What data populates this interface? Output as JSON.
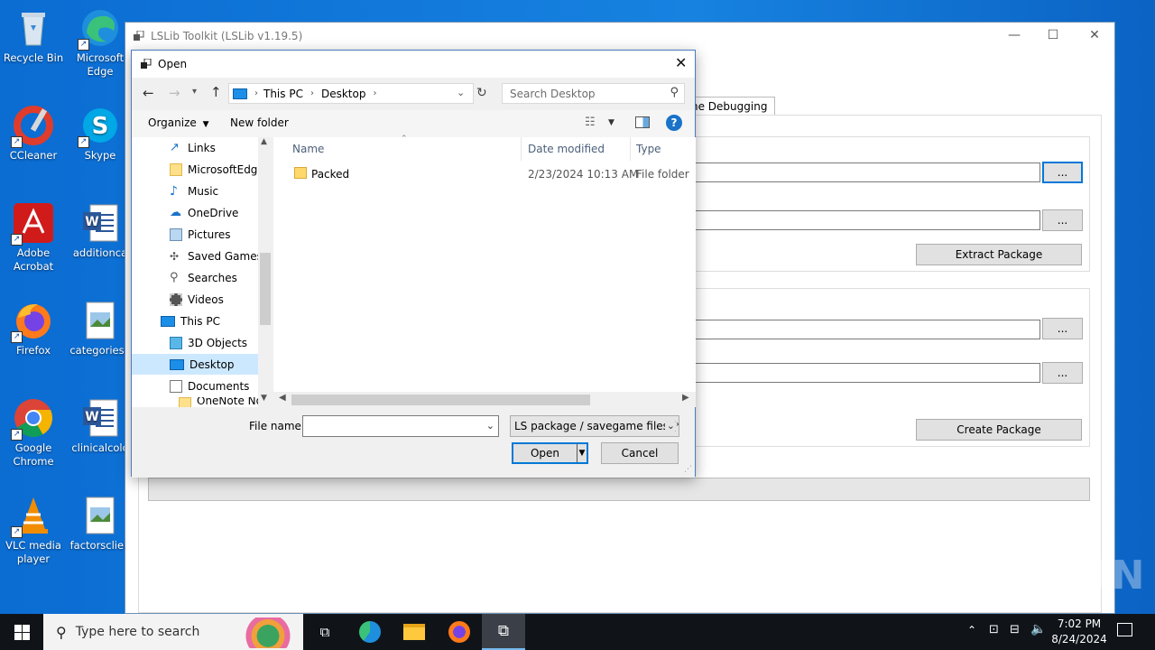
{
  "desktop": {
    "icons": [
      {
        "label1": "Recycle Bin",
        "label2": ""
      },
      {
        "label1": "Microsoft",
        "label2": "Edge"
      },
      {
        "label1": "CCleaner",
        "label2": ""
      },
      {
        "label1": "Skype",
        "label2": ""
      },
      {
        "label1": "Adobe",
        "label2": "Acrobat"
      },
      {
        "label1": "additionca",
        "label2": ""
      },
      {
        "label1": "Firefox",
        "label2": ""
      },
      {
        "label1": "categoriesa",
        "label2": ""
      },
      {
        "label1": "Google",
        "label2": "Chrome"
      },
      {
        "label1": "clinicalcolo",
        "label2": ""
      },
      {
        "label1": "VLC media",
        "label2": "player"
      },
      {
        "label1": "factorsclien",
        "label2": ""
      }
    ]
  },
  "main_window": {
    "title": "LSLib Toolkit (LSLib v1.19.5)",
    "tab_label": "ne Debugging",
    "browse_label": "...",
    "extract_label": "Extract Package",
    "create_label": "Create Package"
  },
  "dialog": {
    "title": "Open",
    "breadcrumb": [
      "This PC",
      "Desktop"
    ],
    "search_placeholder": "Search Desktop",
    "organize_label": "Organize",
    "new_folder_label": "New folder",
    "nav_items": [
      {
        "label": "Links",
        "icon": "link-icon"
      },
      {
        "label": "MicrosoftEdge",
        "icon": "folder-icon"
      },
      {
        "label": "Music",
        "icon": "music-icon"
      },
      {
        "label": "OneDrive",
        "icon": "cloud-icon"
      },
      {
        "label": "Pictures",
        "icon": "pictures-icon"
      },
      {
        "label": "Saved Games",
        "icon": "gamepad-icon"
      },
      {
        "label": "Searches",
        "icon": "search-icon"
      },
      {
        "label": "Videos",
        "icon": "video-icon"
      },
      {
        "label": "This PC",
        "icon": "computer-icon"
      },
      {
        "label": "3D Objects",
        "icon": "cube-icon"
      },
      {
        "label": "Desktop",
        "icon": "desktop-icon"
      },
      {
        "label": "Documents",
        "icon": "document-icon"
      },
      {
        "label": "OneNote Not",
        "icon": "folder-icon"
      }
    ],
    "columns": {
      "name": "Name",
      "date": "Date modified",
      "type": "Type"
    },
    "files": [
      {
        "name": "Packed",
        "date": "2/23/2024 10:13 AM",
        "type": "File folder"
      }
    ],
    "file_name_label": "File name:",
    "file_name_value": "",
    "file_type": "LS package / savegame files (*.p",
    "open_label": "Open",
    "cancel_label": "Cancel"
  },
  "taskbar": {
    "search_placeholder": "Type here to search",
    "time": "7:02 PM",
    "date": "8/24/2024"
  },
  "watermark": "ANY RUN"
}
